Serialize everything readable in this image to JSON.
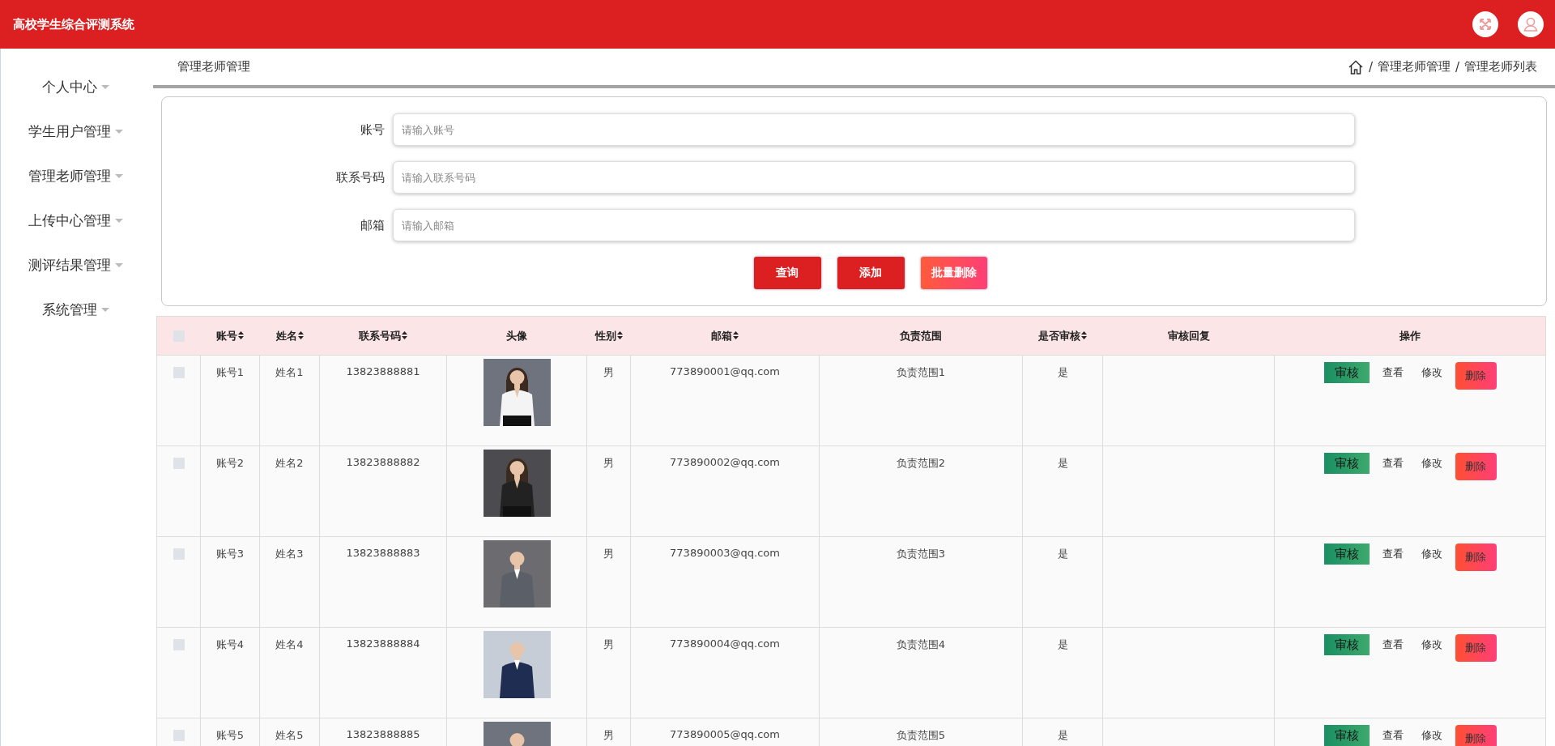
{
  "header": {
    "title": "高校学生综合评测系统"
  },
  "sidebar": {
    "items": [
      {
        "label": "个人中心"
      },
      {
        "label": "学生用户管理"
      },
      {
        "label": "管理老师管理"
      },
      {
        "label": "上传中心管理"
      },
      {
        "label": "测评结果管理"
      },
      {
        "label": "系统管理"
      }
    ]
  },
  "page_title": "管理老师管理",
  "breadcrumb": [
    {
      "separator": "/",
      "label": "管理老师管理"
    },
    {
      "separator": "/",
      "label": "管理老师列表"
    }
  ],
  "search": {
    "fields": [
      {
        "label": "账号",
        "placeholder": "请输入账号"
      },
      {
        "label": "联系号码",
        "placeholder": "请输入联系号码"
      },
      {
        "label": "邮箱",
        "placeholder": "请输入邮箱"
      }
    ],
    "buttons": [
      {
        "label": "查询",
        "kind": "primary"
      },
      {
        "label": "添加",
        "kind": "primary"
      },
      {
        "label": "批量删除",
        "kind": "danger"
      }
    ]
  },
  "table": {
    "select_all": {
      "checked": false
    },
    "columns": [
      {
        "label": "账号",
        "sortable": true
      },
      {
        "label": "姓名",
        "sortable": true
      },
      {
        "label": "联系号码",
        "sortable": true
      },
      {
        "label": "头像",
        "sortable": false
      },
      {
        "label": "性别",
        "sortable": true
      },
      {
        "label": "邮箱",
        "sortable": true
      },
      {
        "label": "负责范围",
        "sortable": false
      },
      {
        "label": "是否审核",
        "sortable": true
      },
      {
        "label": "审核回复",
        "sortable": false
      },
      {
        "label": "操作",
        "sortable": false
      }
    ],
    "rows": [
      {
        "checked": false,
        "account": "账号1",
        "name": "姓名1",
        "phone": "13823888881",
        "avatar": {
          "kind": "picture"
        },
        "gender": "男",
        "email": "773890001@qq.com",
        "scope": "负责范围1",
        "reviewed": "是",
        "actions": [
          {
            "label": "审核",
            "kind": "review"
          },
          {
            "label": "查看",
            "kind": "link"
          },
          {
            "label": "修改",
            "kind": "link"
          },
          {
            "label": "删除",
            "kind": "danger"
          }
        ]
      },
      {
        "checked": false,
        "account": "账号2",
        "name": "姓名2",
        "phone": "13823888882",
        "avatar": {
          "kind": "picture"
        },
        "gender": "男",
        "email": "773890002@qq.com",
        "scope": "负责范围2",
        "reviewed": "是",
        "actions": [
          {
            "label": "审核",
            "kind": "review"
          },
          {
            "label": "查看",
            "kind": "link"
          },
          {
            "label": "修改",
            "kind": "link"
          },
          {
            "label": "删除",
            "kind": "danger"
          }
        ]
      },
      {
        "checked": false,
        "account": "账号3",
        "name": "姓名3",
        "phone": "13823888883",
        "avatar": {
          "kind": "picture"
        },
        "gender": "男",
        "email": "773890003@qq.com",
        "scope": "负责范围3",
        "reviewed": "是",
        "actions": [
          {
            "label": "审核",
            "kind": "review"
          },
          {
            "label": "查看",
            "kind": "link"
          },
          {
            "label": "修改",
            "kind": "link"
          },
          {
            "label": "删除",
            "kind": "danger"
          }
        ]
      },
      {
        "checked": false,
        "account": "账号4",
        "name": "姓名4",
        "phone": "13823888884",
        "avatar": {
          "kind": "picture"
        },
        "gender": "男",
        "email": "773890004@qq.com",
        "scope": "负责范围4",
        "reviewed": "是",
        "actions": [
          {
            "label": "审核",
            "kind": "review"
          },
          {
            "label": "查看",
            "kind": "link"
          },
          {
            "label": "修改",
            "kind": "link"
          },
          {
            "label": "删除",
            "kind": "danger"
          }
        ]
      },
      {
        "checked": false,
        "account": "账号5",
        "name": "姓名5",
        "phone": "13823888885",
        "avatar": {
          "kind": "picture"
        },
        "gender": "男",
        "email": "773890005@qq.com",
        "scope": "负责范围5",
        "reviewed": "是",
        "actions": [
          {
            "label": "审核",
            "kind": "review"
          },
          {
            "label": "查看",
            "kind": "link"
          },
          {
            "label": "修改",
            "kind": "link"
          },
          {
            "label": "删除",
            "kind": "danger"
          }
        ]
      }
    ]
  }
}
